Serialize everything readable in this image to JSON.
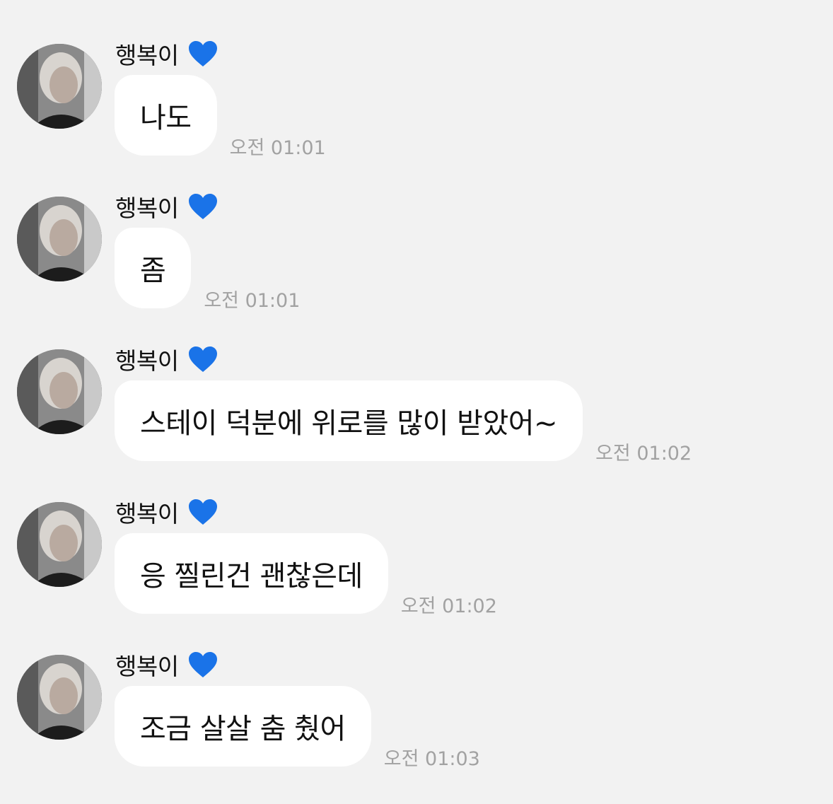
{
  "heart_color": "#1a73e8",
  "messages": [
    {
      "sender": "행복이",
      "text": "나도",
      "time": "오전 01:01"
    },
    {
      "sender": "행복이",
      "text": "좀",
      "time": "오전 01:01"
    },
    {
      "sender": "행복이",
      "text": "스테이 덕분에 위로를 많이 받았어~",
      "time": "오전 01:02"
    },
    {
      "sender": "행복이",
      "text": "응 찔린건 괜찮은데",
      "time": "오전 01:02"
    },
    {
      "sender": "행복이",
      "text": "조금 살살 춤 췄어",
      "time": "오전 01:03"
    }
  ]
}
